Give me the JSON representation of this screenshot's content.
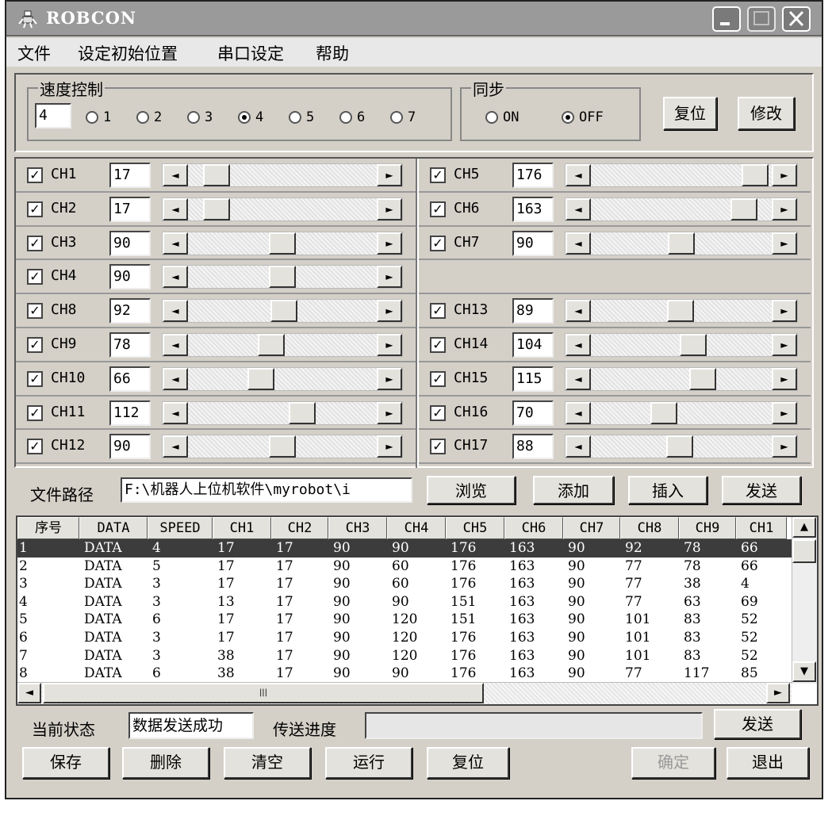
{
  "window": {
    "title": "ROBCON"
  },
  "menu": [
    "文件",
    "设定初始位置",
    "串口设定",
    "帮助"
  ],
  "speed_control": {
    "title": "速度控制",
    "value": "4",
    "options": [
      "1",
      "2",
      "3",
      "4",
      "5",
      "6",
      "7"
    ],
    "selected": "4"
  },
  "sync": {
    "title": "同步",
    "on_label": "ON",
    "off_label": "OFF",
    "selected": "OFF"
  },
  "buttons_top": {
    "reset": "复位",
    "modify": "修改"
  },
  "scroll_arrows": {
    "left": "◄",
    "right": "►"
  },
  "check_mark": "✓",
  "channels": {
    "left": [
      {
        "name": "CH1",
        "value": "17",
        "checked": true
      },
      {
        "name": "CH2",
        "value": "17",
        "checked": true
      },
      {
        "name": "CH3",
        "value": "90",
        "checked": true
      },
      {
        "name": "CH4",
        "value": "90",
        "checked": true
      },
      {
        "name": "CH8",
        "value": "92",
        "checked": true
      },
      {
        "name": "CH9",
        "value": "78",
        "checked": true
      },
      {
        "name": "CH10",
        "value": "66",
        "checked": true
      },
      {
        "name": "CH11",
        "value": "112",
        "checked": true
      },
      {
        "name": "CH12",
        "value": "90",
        "checked": true
      }
    ],
    "right": [
      {
        "name": "CH5",
        "value": "176",
        "checked": true
      },
      {
        "name": "CH6",
        "value": "163",
        "checked": true
      },
      {
        "name": "CH7",
        "value": "90",
        "checked": true
      },
      null,
      {
        "name": "CH13",
        "value": "89",
        "checked": true
      },
      {
        "name": "CH14",
        "value": "104",
        "checked": true
      },
      {
        "name": "CH15",
        "value": "115",
        "checked": true
      },
      {
        "name": "CH16",
        "value": "70",
        "checked": true
      },
      {
        "name": "CH17",
        "value": "88",
        "checked": true
      }
    ],
    "slider_range": [
      0,
      180
    ]
  },
  "file_path": {
    "label": "文件路径",
    "value": "F:\\机器人上位机软件\\myrobot\\i",
    "browse": "浏览",
    "add": "添加",
    "insert": "插入",
    "send": "发送"
  },
  "table": {
    "columns": [
      "序号",
      "DATA",
      "SPEED",
      "CH1",
      "CH2",
      "CH3",
      "CH4",
      "CH5",
      "CH6",
      "CH7",
      "CH8",
      "CH9",
      "CH1"
    ],
    "rows": [
      [
        "1",
        "DATA",
        "4",
        "17",
        "17",
        "90",
        "90",
        "176",
        "163",
        "90",
        "92",
        "78",
        "66"
      ],
      [
        "2",
        "DATA",
        "5",
        "17",
        "17",
        "90",
        "60",
        "176",
        "163",
        "90",
        "77",
        "78",
        "66"
      ],
      [
        "3",
        "DATA",
        "3",
        "17",
        "17",
        "90",
        "60",
        "176",
        "163",
        "90",
        "77",
        "38",
        "4"
      ],
      [
        "4",
        "DATA",
        "3",
        "13",
        "17",
        "90",
        "90",
        "151",
        "163",
        "90",
        "77",
        "63",
        "69"
      ],
      [
        "5",
        "DATA",
        "6",
        "17",
        "17",
        "90",
        "120",
        "151",
        "163",
        "90",
        "101",
        "83",
        "52"
      ],
      [
        "6",
        "DATA",
        "3",
        "17",
        "17",
        "90",
        "120",
        "176",
        "163",
        "90",
        "101",
        "83",
        "52"
      ],
      [
        "7",
        "DATA",
        "3",
        "38",
        "17",
        "90",
        "120",
        "176",
        "163",
        "90",
        "101",
        "83",
        "52"
      ],
      [
        "8",
        "DATA",
        "6",
        "38",
        "17",
        "90",
        "90",
        "176",
        "163",
        "90",
        "77",
        "117",
        "85"
      ]
    ],
    "selected_row": 0
  },
  "status": {
    "label": "当前状态",
    "value": "数据发送成功",
    "progress_label": "传送进度",
    "progress": 0,
    "send": "发送"
  },
  "bottom_buttons": {
    "save": "保存",
    "delete": "删除",
    "clear": "清空",
    "run": "运行",
    "reset": "复位",
    "ok": "确定",
    "exit": "退出"
  }
}
